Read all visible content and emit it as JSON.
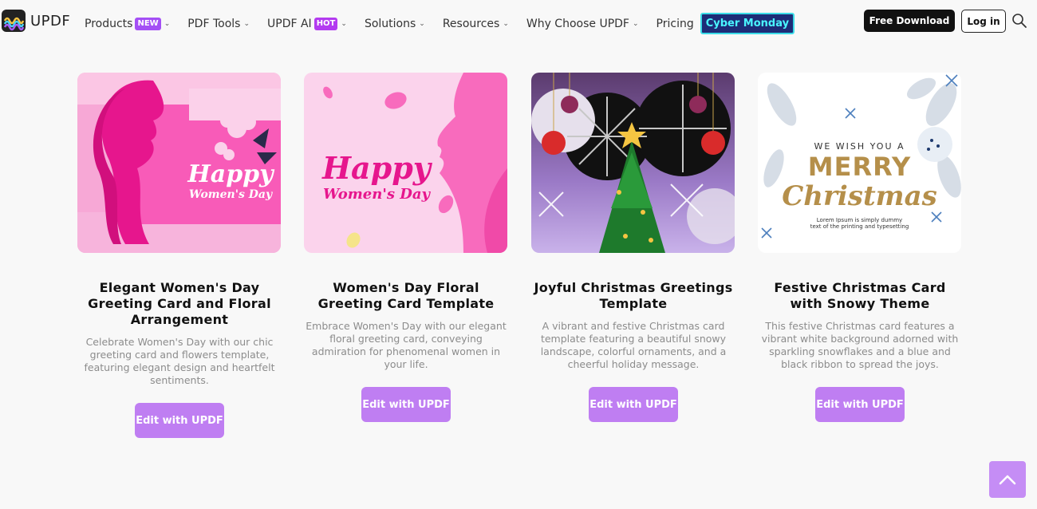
{
  "nav": {
    "logo_text": "UPDF",
    "items": [
      {
        "label": "Products",
        "badge": "NEW",
        "chevron": true
      },
      {
        "label": "PDF Tools",
        "badge": "",
        "chevron": true
      },
      {
        "label": "UPDF AI",
        "badge": "HOT",
        "chevron": true
      },
      {
        "label": "Solutions",
        "badge": "",
        "chevron": true
      },
      {
        "label": "Resources",
        "badge": "",
        "chevron": true
      },
      {
        "label": "Why Choose UPDF",
        "badge": "",
        "chevron": true
      },
      {
        "label": "Pricing",
        "badge": "",
        "chevron": false
      }
    ],
    "promo": "Cyber Monday",
    "download_label": "Free Download",
    "login_label": "Log in"
  },
  "cards": [
    {
      "title": "Elegant Women's Day Greeting Card and Floral Arrangement",
      "description": "Celebrate Women's Day with our chic greeting card and flowers template, featuring elegant design and heartfelt sentiments.",
      "button": "Edit with UPDF",
      "image_text": [
        "Happy",
        "Women's Day"
      ]
    },
    {
      "title": "Women's Day Floral Greeting Card Template",
      "description": "Embrace Women's Day with our elegant floral greeting card, conveying admiration for phenomenal women in your life.",
      "button": "Edit with UPDF",
      "image_text": [
        "Happy",
        "Women's Day"
      ]
    },
    {
      "title": "Joyful Christmas Greetings Template",
      "description": "A vibrant and festive Christmas card template featuring a beautiful snowy landscape, colorful ornaments, and a cheerful holiday message.",
      "button": "Edit with UPDF",
      "image_text": []
    },
    {
      "title": "Festive Christmas Card with Snowy Theme",
      "description": "This festive Christmas card features a vibrant white background adorned with sparkling snowflakes and a blue and black ribbon to spread the joys.",
      "button": "Edit with UPDF",
      "image_text": [
        "WE WISH YOU A",
        "MERRY",
        "Christmas",
        "Lorem Ipsum is simply dummy",
        "text of the printing and typesetting"
      ]
    }
  ],
  "colors": {
    "accent": "#bf7ef2",
    "badge_new": "#a44ff5",
    "promo_bg": "#1d2c77",
    "promo_text": "#4af6ff"
  },
  "icons": {
    "search": "search-icon",
    "back_to_top": "chevron-up-icon"
  }
}
